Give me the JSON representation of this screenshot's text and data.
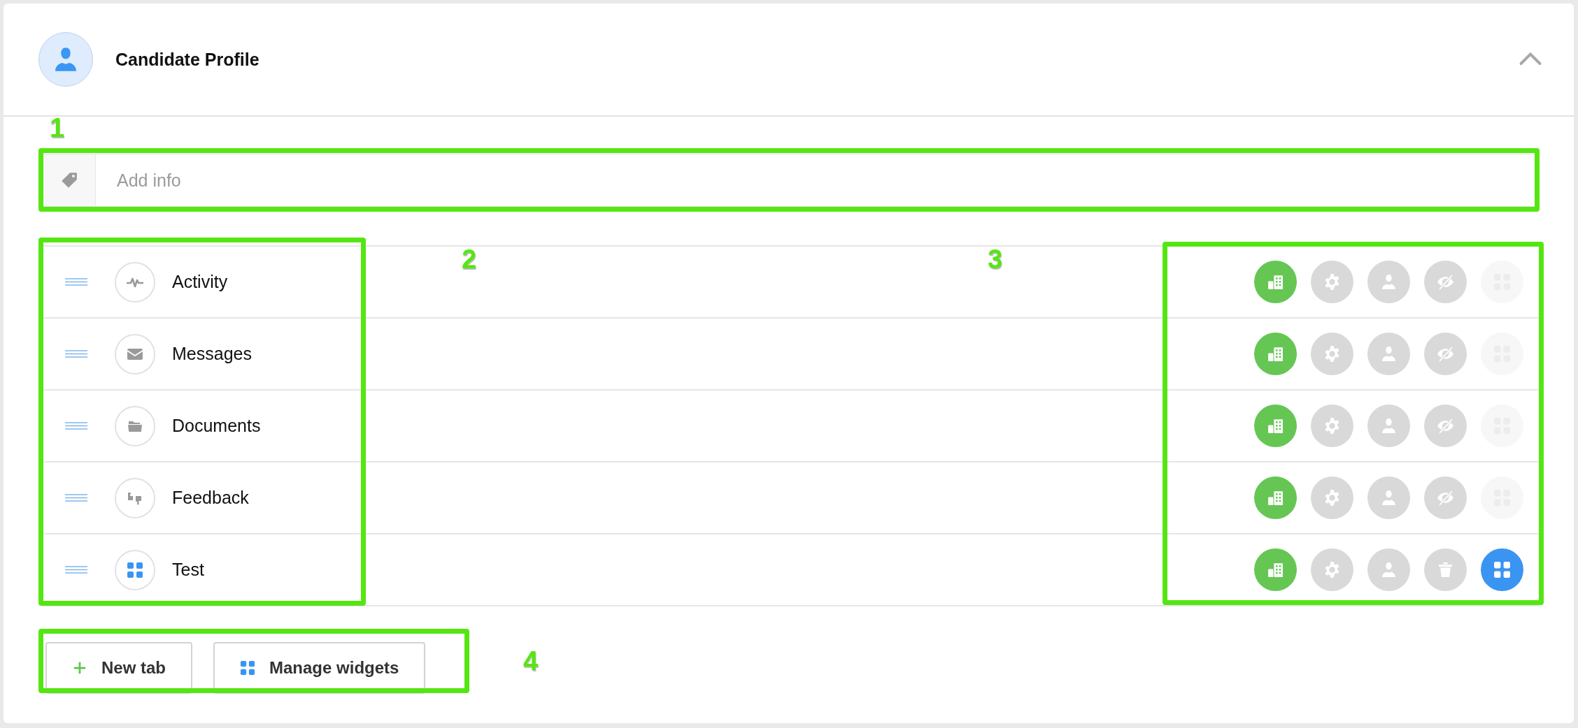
{
  "header": {
    "title": "Candidate Profile",
    "expanded": true
  },
  "info_field": {
    "placeholder": "Add info"
  },
  "tabs": [
    {
      "label": "Activity",
      "kind": "activity",
      "actions": [
        {
          "kind": "building",
          "on": true
        },
        {
          "kind": "gear",
          "on": false
        },
        {
          "kind": "person",
          "on": false
        },
        {
          "kind": "hide",
          "on": false
        },
        {
          "kind": "widgets",
          "on": false
        }
      ]
    },
    {
      "label": "Messages",
      "kind": "messages",
      "actions": [
        {
          "kind": "building",
          "on": true
        },
        {
          "kind": "gear",
          "on": false
        },
        {
          "kind": "person",
          "on": false
        },
        {
          "kind": "hide",
          "on": false
        },
        {
          "kind": "widgets",
          "on": false
        }
      ]
    },
    {
      "label": "Documents",
      "kind": "documents",
      "actions": [
        {
          "kind": "building",
          "on": true
        },
        {
          "kind": "gear",
          "on": false
        },
        {
          "kind": "person",
          "on": false
        },
        {
          "kind": "hide",
          "on": false
        },
        {
          "kind": "widgets",
          "on": false
        }
      ]
    },
    {
      "label": "Feedback",
      "kind": "feedback",
      "actions": [
        {
          "kind": "building",
          "on": true
        },
        {
          "kind": "gear",
          "on": false
        },
        {
          "kind": "person",
          "on": false
        },
        {
          "kind": "hide",
          "on": false
        },
        {
          "kind": "widgets",
          "on": false
        }
      ]
    },
    {
      "label": "Test",
      "kind": "widgets",
      "actions": [
        {
          "kind": "building",
          "on": true
        },
        {
          "kind": "gear",
          "on": false
        },
        {
          "kind": "person",
          "on": false
        },
        {
          "kind": "delete",
          "on": false
        },
        {
          "kind": "widgets",
          "on": true
        }
      ]
    }
  ],
  "buttons": [
    {
      "kind": "add",
      "label": "New tab"
    },
    {
      "kind": "widgets",
      "label": "Manage widgets"
    }
  ],
  "annotations": [
    {
      "label": "1"
    },
    {
      "label": "2"
    },
    {
      "label": "3"
    },
    {
      "label": "4"
    }
  ]
}
